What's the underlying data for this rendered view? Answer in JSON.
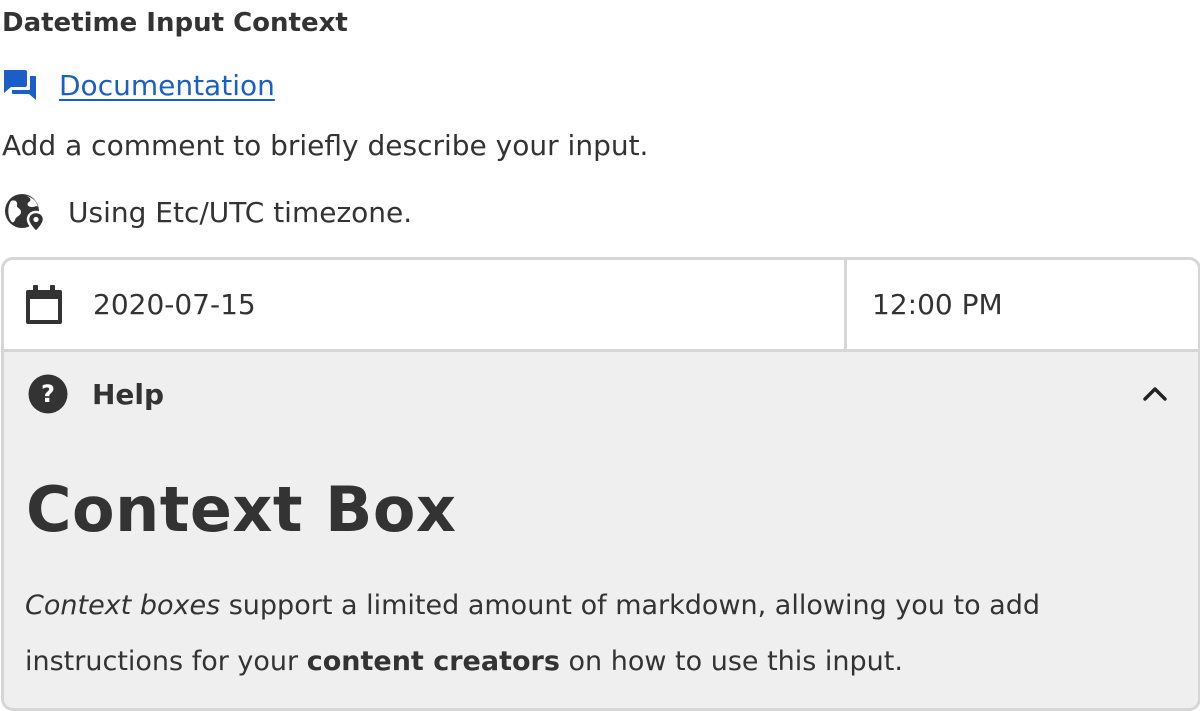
{
  "header": {
    "title": "Datetime Input Context"
  },
  "documentation": {
    "icon": "chat-bubbles-icon",
    "link_label": "Documentation",
    "link_color": "#1a5fc8"
  },
  "comment": {
    "text": "Add a comment to briefly describe your input."
  },
  "timezone": {
    "icon": "globe-location-icon",
    "text": "Using Etc/UTC timezone."
  },
  "datetime_input": {
    "date_icon": "calendar-icon",
    "date_value": "2020-07-15",
    "time_value": "12:00 PM"
  },
  "help": {
    "icon": "question-circle-icon",
    "label": "Help",
    "toggle_icon": "chevron-up-icon",
    "expanded": true
  },
  "context_box": {
    "heading": "Context Box",
    "body_italic": "Context boxes",
    "body_part1": " support a limited amount of markdown, allowing you to add instructions for your ",
    "body_bold": "content creators",
    "body_part2": " on how to use this input."
  },
  "colors": {
    "text": "#333333",
    "link": "#1a5fc8",
    "border": "#d6d6d6",
    "help_background": "#efefef"
  }
}
